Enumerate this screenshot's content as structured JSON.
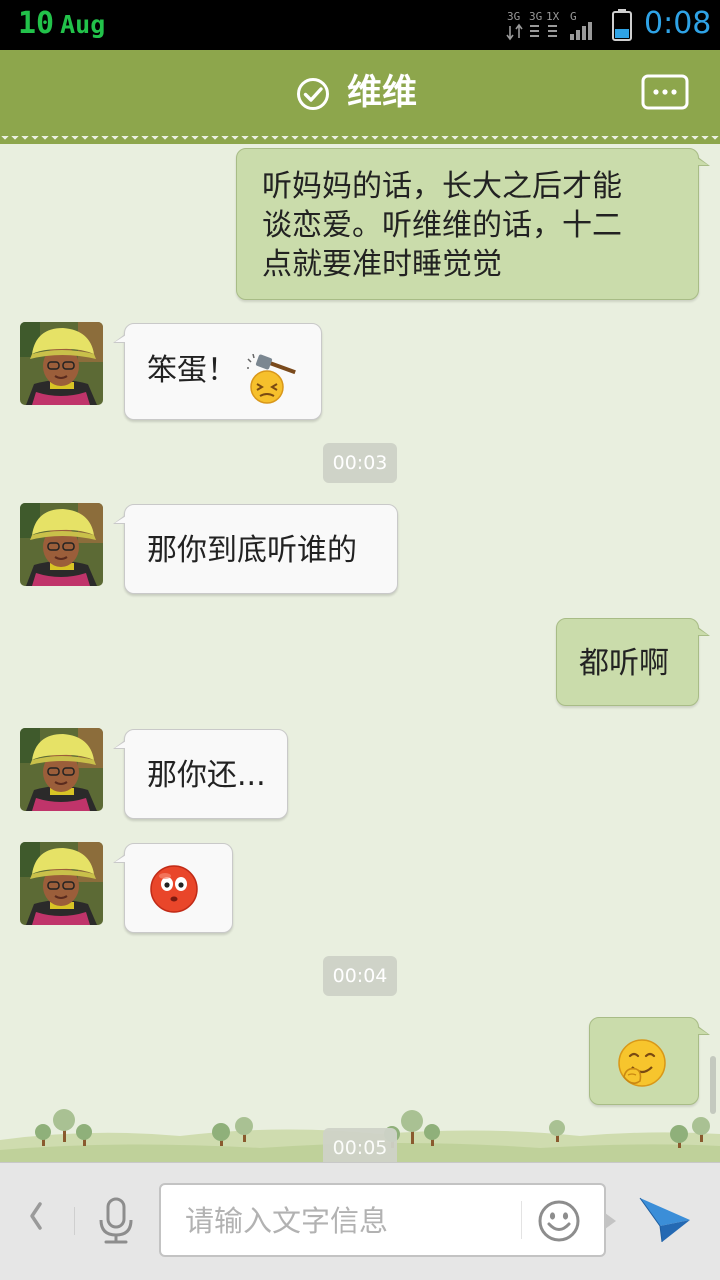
{
  "status_bar": {
    "date_day": "10",
    "date_month": "Aug",
    "network_labels": [
      "3G",
      "3G",
      "1X",
      "G"
    ],
    "time": "0:08",
    "colors": {
      "date": "#22c24a",
      "time": "#2fa3e6",
      "battery": "#2fa3e6"
    }
  },
  "header": {
    "title": "维维",
    "verified_icon": "check-circle-icon",
    "more_icon": "ellipsis-box-icon",
    "background": "#8da64c"
  },
  "messages": [
    {
      "side": "out",
      "text": "听妈妈的话，长大之后才能",
      "text2": "谈恋爱。听维维的话，十二",
      "text3": "点就要准时睡觉觉"
    },
    {
      "side": "in",
      "text": "笨蛋！",
      "emoji": "hammer-hit-emoji"
    },
    {
      "type": "time",
      "text": "00:03"
    },
    {
      "side": "in",
      "text": "那你到底听谁的"
    },
    {
      "side": "out",
      "text": "都听啊"
    },
    {
      "side": "in",
      "text": "那你还..."
    },
    {
      "side": "in",
      "emoji": "blushing-face-emoji"
    },
    {
      "type": "time",
      "text": "00:04"
    },
    {
      "side": "out",
      "emoji": "shy-laugh-emoji"
    },
    {
      "type": "time",
      "text": "00:05"
    }
  ],
  "input_bar": {
    "placeholder": "请输入文字信息",
    "back_icon": "chevron-left-icon",
    "mic_icon": "microphone-icon",
    "emoji_icon": "smiley-icon",
    "send_icon": "paper-plane-icon",
    "send_color": "#3b8ed8"
  }
}
